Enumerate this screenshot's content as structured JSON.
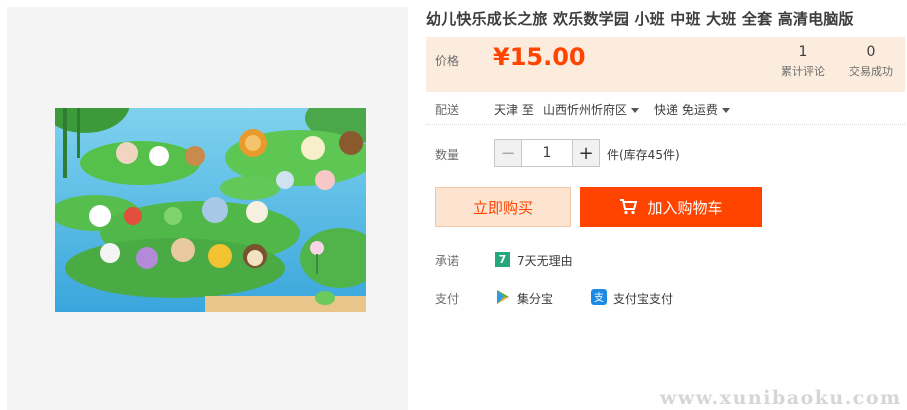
{
  "product": {
    "title": "幼儿快乐成长之旅 欢乐数学园 小班 中班 大班 全套 高清电脑版",
    "image_alt": "cartoon animals on lily pads"
  },
  "price": {
    "label": "价格",
    "value": "¥15.00"
  },
  "stats": {
    "reviews_count": "1",
    "reviews_label": "累计评论",
    "sales_count": "0",
    "sales_label": "交易成功"
  },
  "shipping": {
    "label": "配送",
    "from": "天津 至",
    "to": "山西忻州忻府区",
    "method": "快递 免运费"
  },
  "quantity": {
    "label": "数量",
    "minus": "−",
    "value": "1",
    "plus": "+",
    "stock": "件(库存45件)"
  },
  "actions": {
    "buy_now": "立即购买",
    "add_to_cart": "加入购物车"
  },
  "promise": {
    "label": "承诺",
    "badge": "7",
    "text": "7天无理由"
  },
  "payment": {
    "label": "支付",
    "option1": "集分宝",
    "option2": "支付宝支付"
  },
  "watermark": "www.xunibaoku.com",
  "colors": {
    "accent": "#ff4400",
    "price_panel_bg": "#fcecde",
    "buy_now_bg": "#fde4d0",
    "promise_green": "#25a67b"
  }
}
